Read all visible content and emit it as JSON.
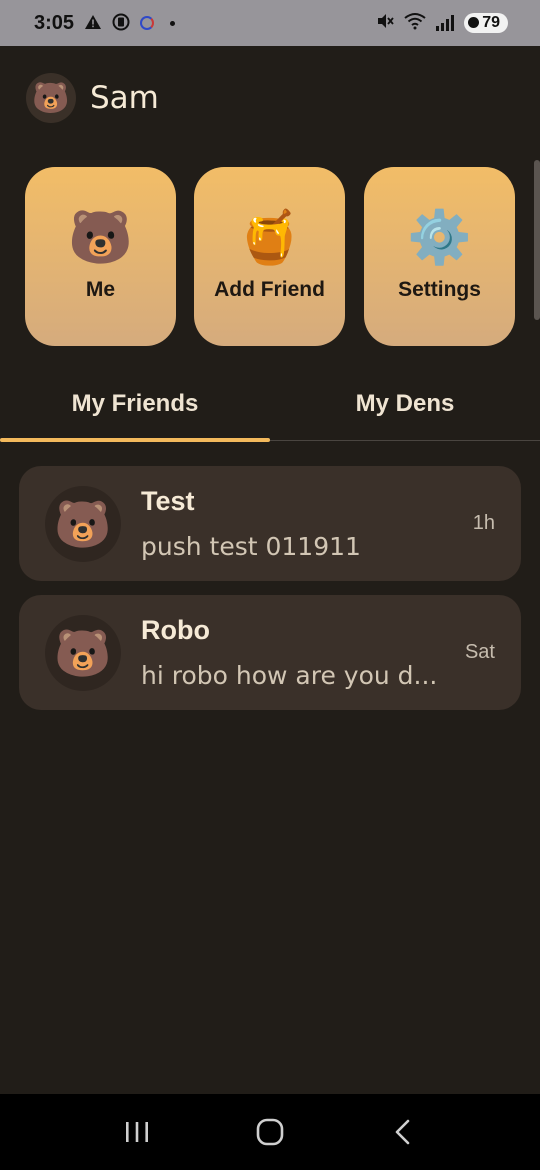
{
  "status_bar": {
    "time": "3:05",
    "battery": "79",
    "icons": [
      "warning-icon",
      "app-icon",
      "loading-ring-icon",
      "dot-icon",
      "mute-icon",
      "wifi-icon",
      "signal-icon",
      "battery-icon"
    ]
  },
  "header": {
    "name": "Sam",
    "avatar_icon": "bear-face-icon",
    "avatar_glyph": "🐻"
  },
  "actions": [
    {
      "label": "Me",
      "icon": "bear-face-icon",
      "glyph": "🐻"
    },
    {
      "label": "Add Friend",
      "icon": "honey-pot-icon",
      "glyph": "🍯"
    },
    {
      "label": "Settings",
      "icon": "gear-icon",
      "glyph": "⚙️"
    }
  ],
  "tabs": [
    {
      "label": "My Friends",
      "selected": true
    },
    {
      "label": "My Dens",
      "selected": false
    }
  ],
  "friends": [
    {
      "name": "Test",
      "message": "push test 011911",
      "time": "1h",
      "avatar_glyph": "🐻"
    },
    {
      "name": "Robo",
      "message": "hi robo how are you d...",
      "time": "Sat",
      "avatar_glyph": "🐻"
    }
  ],
  "colors": {
    "background": "#211d18",
    "card_gradient_top": "#f2bd67",
    "card_gradient_bottom": "#d5ab7d",
    "tab_indicator": "#f3b95c",
    "list_card": "#3a3029"
  },
  "nav_bar": {
    "icons": [
      "recent-apps-icon",
      "home-icon",
      "back-icon"
    ]
  }
}
